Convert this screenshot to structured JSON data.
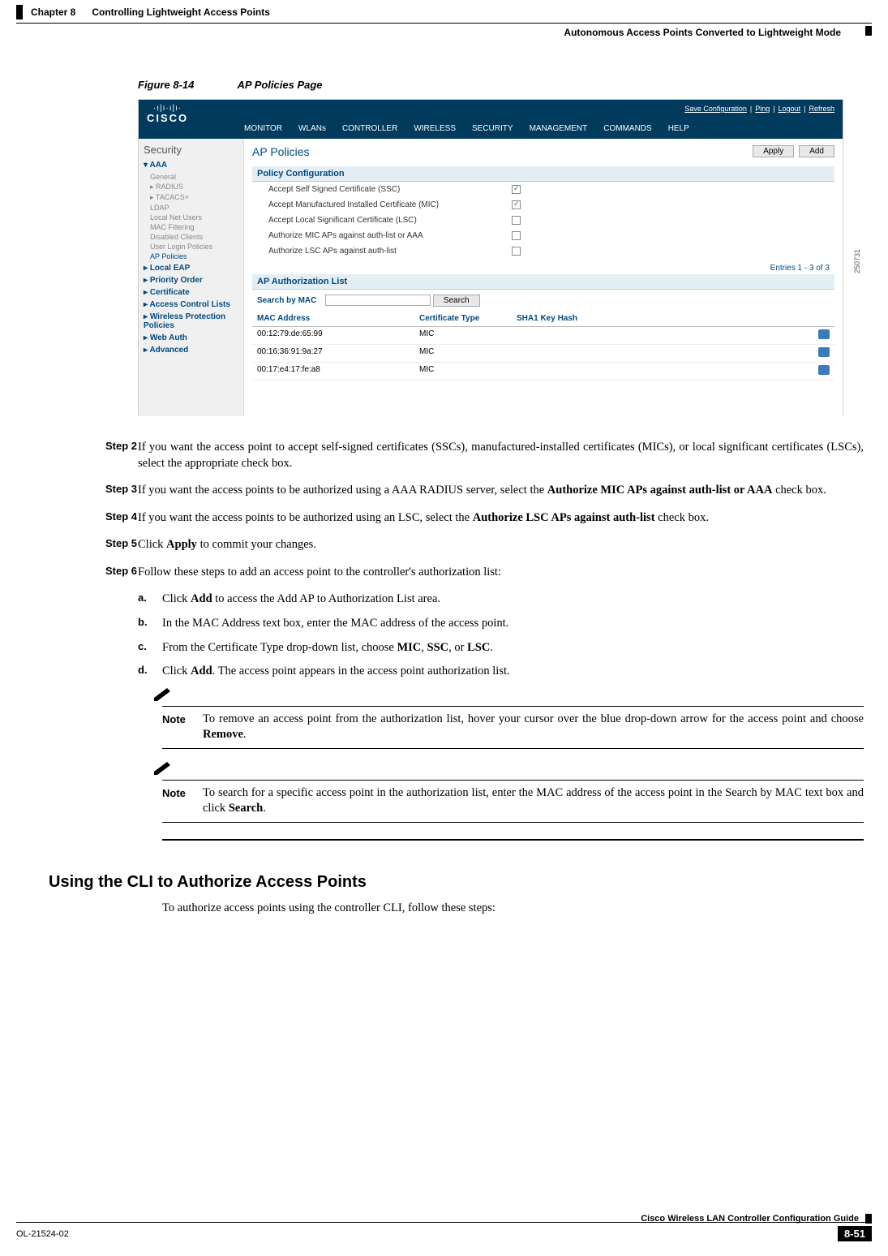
{
  "header": {
    "chapter": "Chapter 8",
    "chapter_title": "Controlling Lightweight Access Points",
    "section": "Autonomous Access Points Converted to Lightweight Mode"
  },
  "figure": {
    "number": "Figure 8-14",
    "title": "AP Policies Page",
    "side_code": "250731"
  },
  "screenshot": {
    "top_links": {
      "save": "Save Configuration",
      "ping": "Ping",
      "logout": "Logout",
      "refresh": "Refresh"
    },
    "logo": "CISCO",
    "menu": [
      "MONITOR",
      "WLANs",
      "CONTROLLER",
      "WIRELESS",
      "SECURITY",
      "MANAGEMENT",
      "COMMANDS",
      "HELP"
    ],
    "sidebar": {
      "title": "Security",
      "groups": {
        "aaa": "AAA",
        "aaa_items": [
          "General",
          "RADIUS",
          "TACACS+",
          "LDAP",
          "Local Net Users",
          "MAC Filtering",
          "Disabled Clients",
          "User Login Policies",
          "AP Policies"
        ],
        "others": [
          "Local EAP",
          "Priority Order",
          "Certificate",
          "Access Control Lists",
          "Wireless Protection Policies",
          "Web Auth",
          "Advanced"
        ]
      }
    },
    "main": {
      "title": "AP Policies",
      "apply_btn": "Apply",
      "add_btn": "Add",
      "policy_head": "Policy Configuration",
      "policies": [
        {
          "label": "Accept Self Signed Certificate (SSC)",
          "checked": true
        },
        {
          "label": "Accept Manufactured Installed Certificate (MIC)",
          "checked": true
        },
        {
          "label": "Accept Local Significant Certificate (LSC)",
          "checked": false
        },
        {
          "label": "Authorize MIC APs against auth-list or AAA",
          "checked": false
        },
        {
          "label": "Authorize LSC APs against auth-list",
          "checked": false
        }
      ],
      "entries": "Entries 1 - 3 of 3",
      "auth_head": "AP Authorization List",
      "search_label": "Search by MAC",
      "search_btn": "Search",
      "cols": {
        "c1": "MAC Address",
        "c2": "Certificate Type",
        "c3": "SHA1 Key Hash"
      },
      "rows": [
        {
          "mac": "00:12:79:de:65:99",
          "cert": "MIC"
        },
        {
          "mac": "00:16:36:91:9a:27",
          "cert": "MIC"
        },
        {
          "mac": "00:17:e4:17:fe:a8",
          "cert": "MIC"
        }
      ]
    }
  },
  "steps": {
    "s2": {
      "label": "Step 2",
      "text_a": "If you want the access point to accept self-signed certificates (SSCs), manufactured-installed certificates (MICs), or local significant certificates (LSCs), select the appropriate check box."
    },
    "s3": {
      "label": "Step 3",
      "text_a": "If you want the access points to be authorized using a AAA RADIUS server, select the ",
      "bold_a": "Authorize MIC APs against auth-list or AAA",
      "text_b": " check box."
    },
    "s4": {
      "label": "Step 4",
      "text_a": "If you want the access points to be authorized using an LSC, select the ",
      "bold_a": "Authorize LSC APs against auth-list",
      "text_b": " check box."
    },
    "s5": {
      "label": "Step 5",
      "text_a": "Click ",
      "bold_a": "Apply",
      "text_b": " to commit your changes."
    },
    "s6": {
      "label": "Step 6",
      "text_a": "Follow these steps to add an access point to the controller's authorization list:"
    },
    "sa": {
      "label": "a.",
      "text_a": "Click ",
      "bold_a": "Add",
      "text_b": " to access the Add AP to Authorization List area."
    },
    "sb": {
      "label": "b.",
      "text_a": "In the MAC Address text box, enter the MAC address of the access point."
    },
    "sc": {
      "label": "c.",
      "text_a": "From the Certificate Type drop-down list, choose ",
      "bold_a": "MIC",
      "mid_a": ", ",
      "bold_b": "SSC",
      "mid_b": ", or ",
      "bold_c": "LSC",
      "text_b": "."
    },
    "sd": {
      "label": "d.",
      "text_a": "Click ",
      "bold_a": "Add",
      "text_b": ". The access point appears in the access point authorization list."
    }
  },
  "notes": {
    "note_label": "Note",
    "n1_a": "To remove an access point from the authorization list, hover your cursor over the blue drop-down arrow for the access point and choose ",
    "n1_bold": "Remove",
    "n1_b": ".",
    "n2_a": "To search for a specific access point in the authorization list, enter the MAC address of the access point in the Search by MAC text box and click ",
    "n2_bold": "Search",
    "n2_b": "."
  },
  "cli_section": {
    "title": "Using the CLI to Authorize Access Points",
    "intro": "To authorize access points using the controller CLI, follow these steps:"
  },
  "footer": {
    "guide": "Cisco Wireless LAN Controller Configuration Guide",
    "doc_id": "OL-21524-02",
    "page": "8-51"
  }
}
